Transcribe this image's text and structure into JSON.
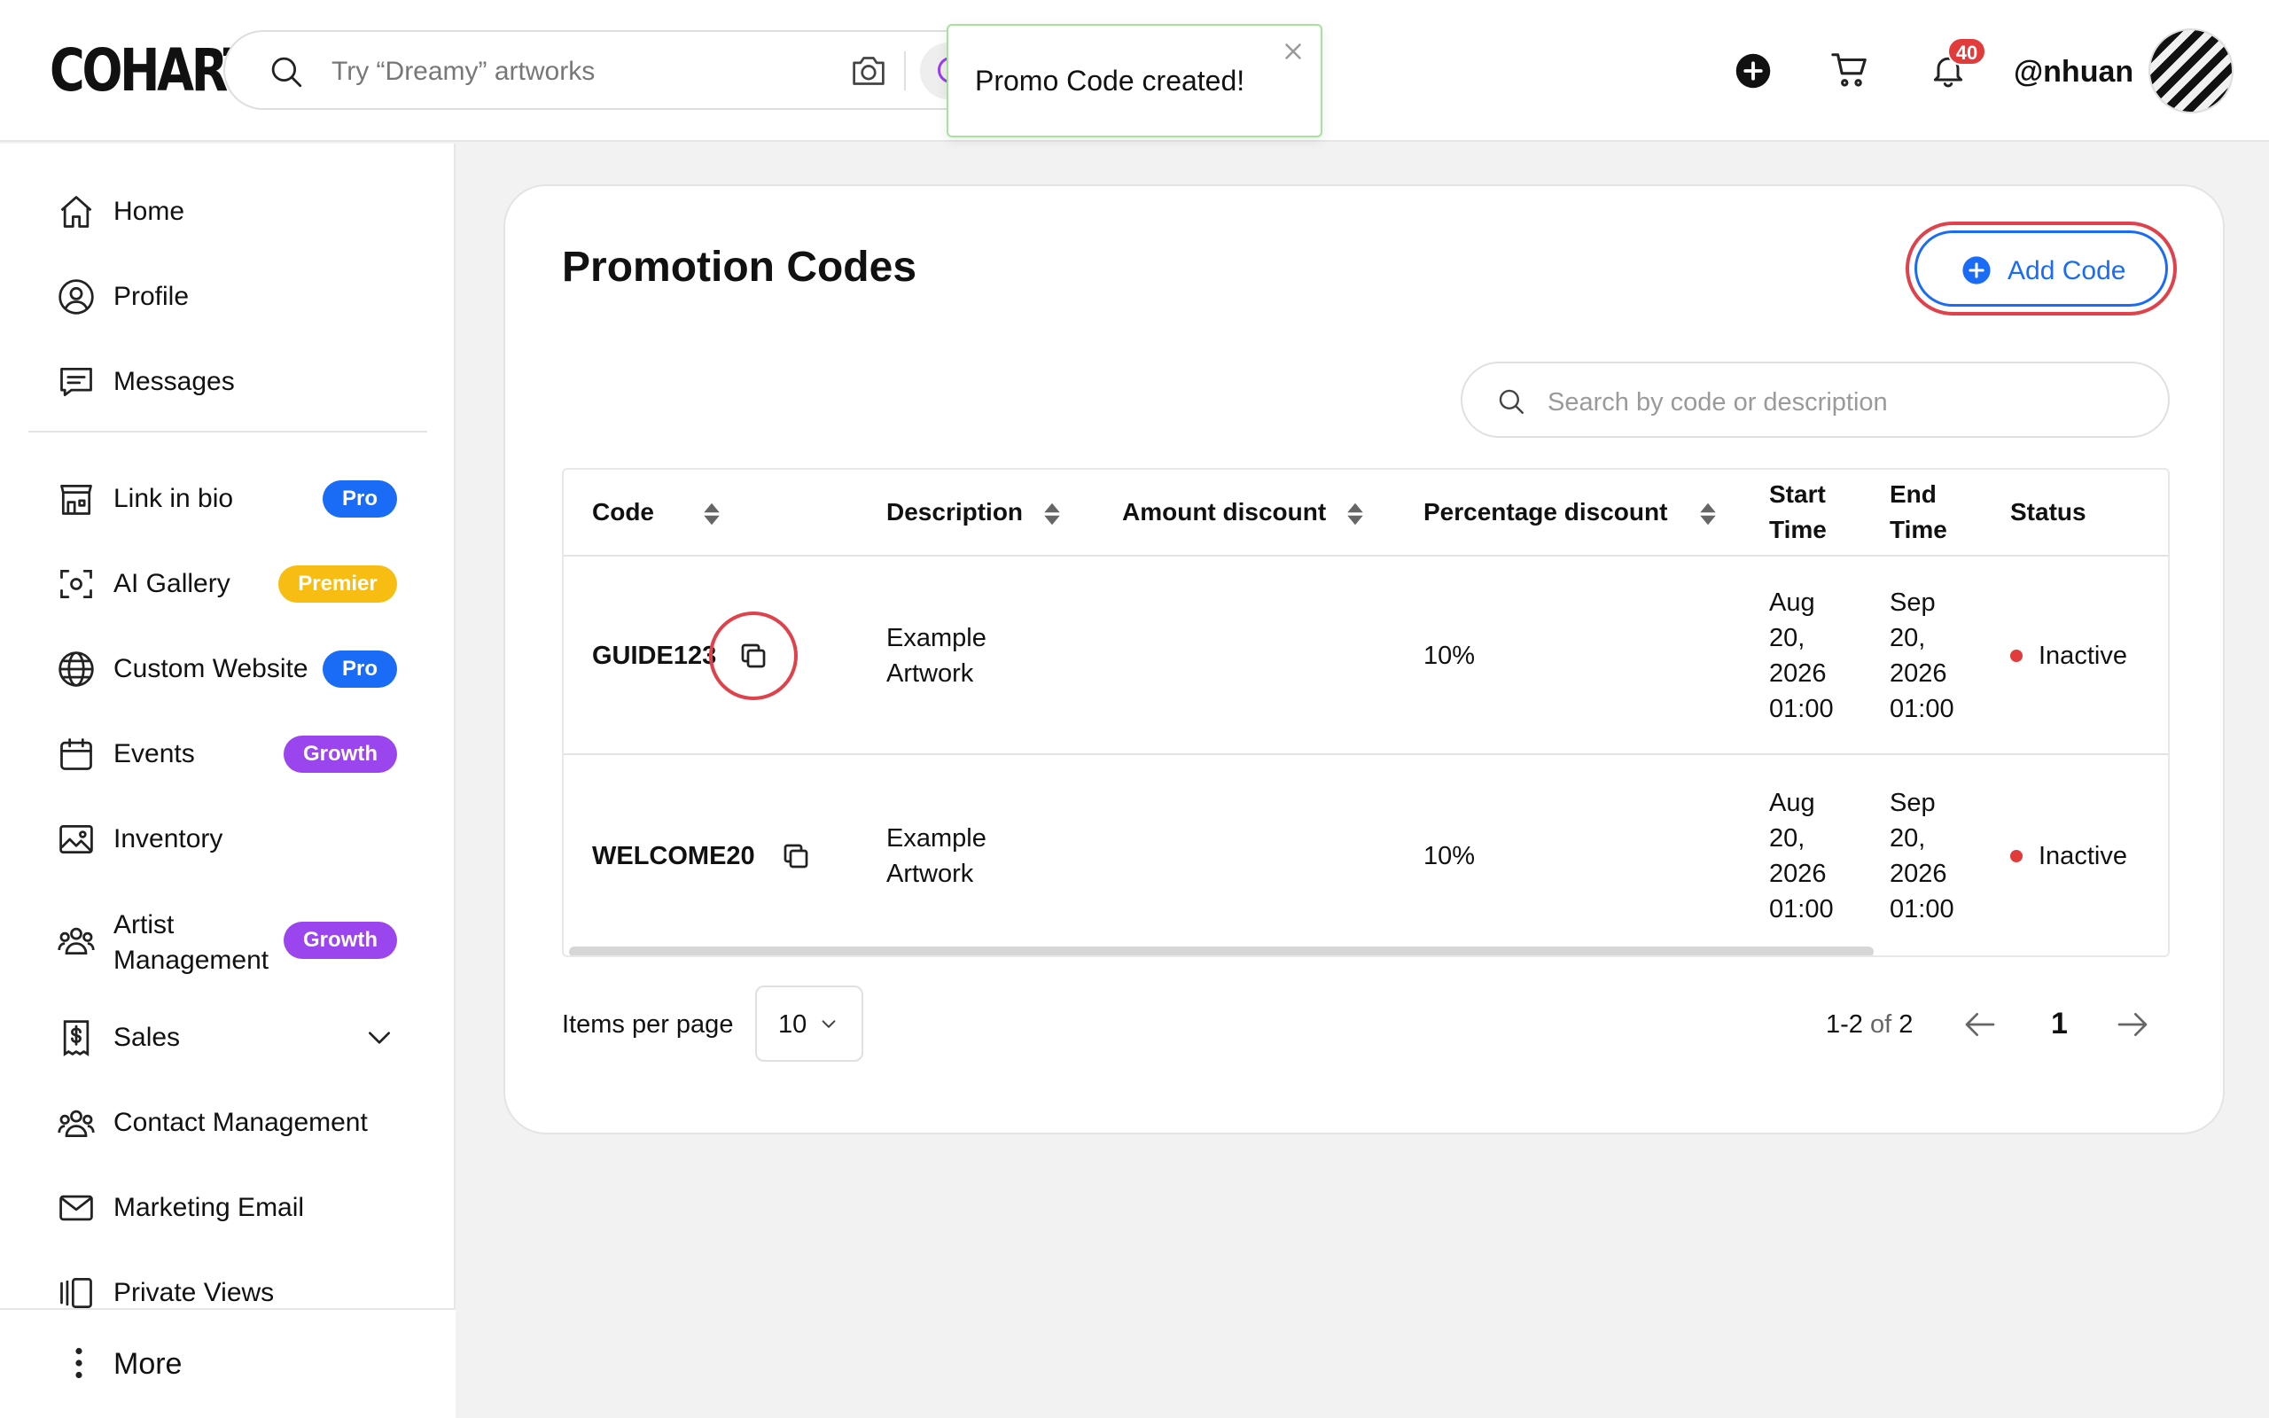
{
  "header": {
    "logo": "COHART",
    "search_placeholder": "Try “Dreamy” artworks",
    "notification_count": "40",
    "username": "@nhuan"
  },
  "toast": {
    "message": "Promo Code created!"
  },
  "sidebar": {
    "items": [
      {
        "label": "Home",
        "icon": "home-icon"
      },
      {
        "label": "Profile",
        "icon": "user-circle-icon"
      },
      {
        "label": "Messages",
        "icon": "message-icon"
      },
      {
        "label": "Link in bio",
        "icon": "storefront-icon",
        "badge": "Pro"
      },
      {
        "label": "AI Gallery",
        "icon": "scan-face-icon",
        "badge": "Premier"
      },
      {
        "label": "Custom Website",
        "icon": "globe-icon",
        "badge": "Pro"
      },
      {
        "label": "Events",
        "icon": "calendar-icon",
        "badge": "Growth"
      },
      {
        "label": "Inventory",
        "icon": "image-icon"
      },
      {
        "label": "Artist\nManagement",
        "icon": "people-icon",
        "badge": "Growth"
      },
      {
        "label": "Sales",
        "icon": "dollar-doc-icon"
      },
      {
        "label": "Contact Management",
        "icon": "people-icon"
      },
      {
        "label": "Marketing Email",
        "icon": "mail-icon"
      },
      {
        "label": "Private Views",
        "icon": "slides-icon"
      }
    ],
    "more_label": "More"
  },
  "main": {
    "title": "Promotion Codes",
    "add_button": "Add Code",
    "search_placeholder": "Search by code or description",
    "table": {
      "columns": [
        "Code",
        "Description",
        "Amount discount",
        "Percentage discount",
        "Start\nTime",
        "End\nTime",
        "Status"
      ],
      "rows": [
        {
          "code": "GUIDE123",
          "description": "Example\nArtwork",
          "amount": "",
          "percentage": "10%",
          "start": "Aug\n20,\n2026\n01:00",
          "end": "Sep\n20,\n2026\n01:00",
          "status": "Inactive"
        },
        {
          "code": "WELCOME20",
          "description": "Example\nArtwork",
          "amount": "",
          "percentage": "10%",
          "start": "Aug\n20,\n2026\n01:00",
          "end": "Sep\n20,\n2026\n01:00",
          "status": "Inactive"
        }
      ]
    },
    "pagination": {
      "items_per_page_label": "Items per page",
      "items_per_page": "10",
      "range": "1-2",
      "of_label": "of",
      "total": "2",
      "current_page": "1"
    }
  },
  "colors": {
    "accent": "#1a6bf5",
    "premier": "#f7bd13",
    "growth": "#9b45ef",
    "inactive": "#e23b3b",
    "highlight": "#e0424c"
  }
}
